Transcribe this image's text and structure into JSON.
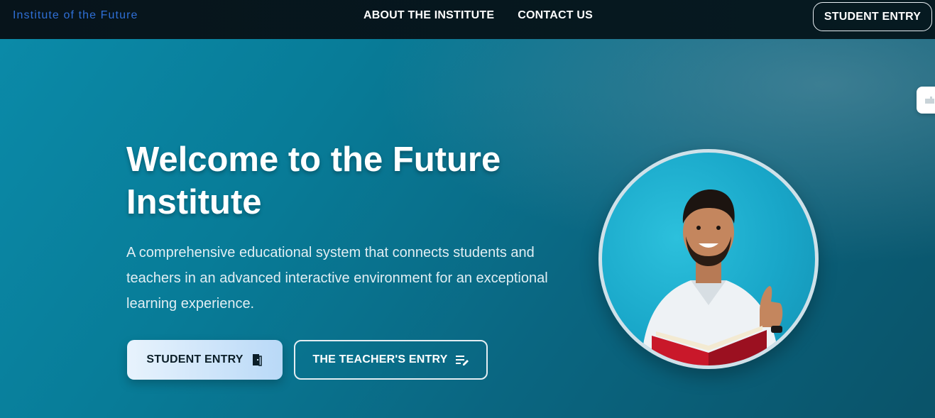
{
  "nav": {
    "brand": "Institute of the Future",
    "links": [
      "ABOUT THE INSTITUTE",
      "CONTACT US"
    ],
    "cta": "STUDENT ENTRY"
  },
  "hero": {
    "title": "Welcome to the Future Institute",
    "description": "A comprehensive educational system that connects students and teachers in an advanced interactive environment for an exceptional learning experience.",
    "primary_button": {
      "label": "STUDENT ENTRY",
      "icon": "door-icon"
    },
    "secondary_button": {
      "label": "THE TEACHER'S ENTRY",
      "icon": "list-edit-icon"
    },
    "image": {
      "subject": "student-holding-book-thumbs-up"
    }
  },
  "side_tab": {
    "icon": "puzzle-icon"
  },
  "colors": {
    "brand": "#2f6fd6",
    "navbar_bg": "#07141b",
    "hero_start": "#0b8aa8",
    "hero_end": "#0a5369",
    "primary_button": "#cfe6fb"
  }
}
